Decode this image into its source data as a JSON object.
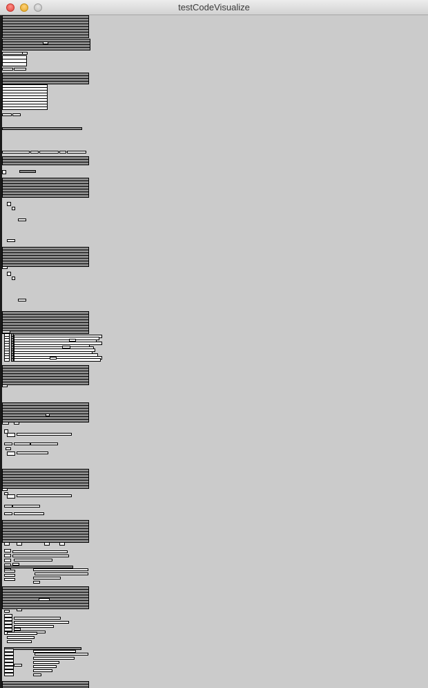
{
  "window": {
    "title": "testCodeVisualize",
    "background_color": "#cbcbcb",
    "traffic_lights": {
      "close_icon": "close-icon",
      "minimize_icon": "minimize-icon",
      "zoom_icon": "zoom-icon"
    }
  },
  "visualization": {
    "block_fill_color": "#8c8c8c",
    "node_fill_color": "#fafafa",
    "outline_color": "#000000"
  }
}
